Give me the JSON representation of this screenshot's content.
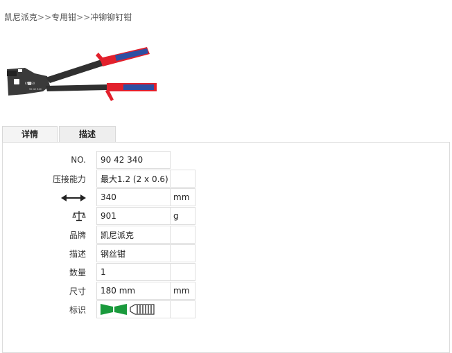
{
  "breadcrumb": {
    "items": [
      "凯尼派克",
      "专用钳",
      "冲铆铆钉钳"
    ],
    "separator": ">>"
  },
  "product_image": {
    "brand_text": "KNIPEX",
    "model_text": "90 42 340"
  },
  "tabs": [
    {
      "label": "详情",
      "active": true
    },
    {
      "label": "描述",
      "active": false
    }
  ],
  "specs": {
    "no": {
      "label": "NO.",
      "value": "90 42 340"
    },
    "crimp": {
      "label": "压接能力",
      "value": "最大1.2 (2 x 0.6)"
    },
    "length": {
      "icon": "length-arrows-icon",
      "value": "340",
      "unit": "mm"
    },
    "weight": {
      "icon": "balance-scale-icon",
      "value": "901",
      "unit": "g"
    },
    "brand": {
      "label": "品牌",
      "value": "凯尼派克"
    },
    "desc": {
      "label": "描述",
      "value": "钢丝钳"
    },
    "qty": {
      "label": "数量",
      "value": "1"
    },
    "size": {
      "label": "尺寸",
      "value": "180 mm",
      "unit": "mm"
    },
    "mark": {
      "label": "标识",
      "icons": [
        "green-jaw-icon",
        "ruler-grip-icon"
      ]
    }
  },
  "colors": {
    "handle_red": "#e2202c",
    "handle_blue": "#2d4fa3",
    "mark_green": "#1a9a3c"
  }
}
